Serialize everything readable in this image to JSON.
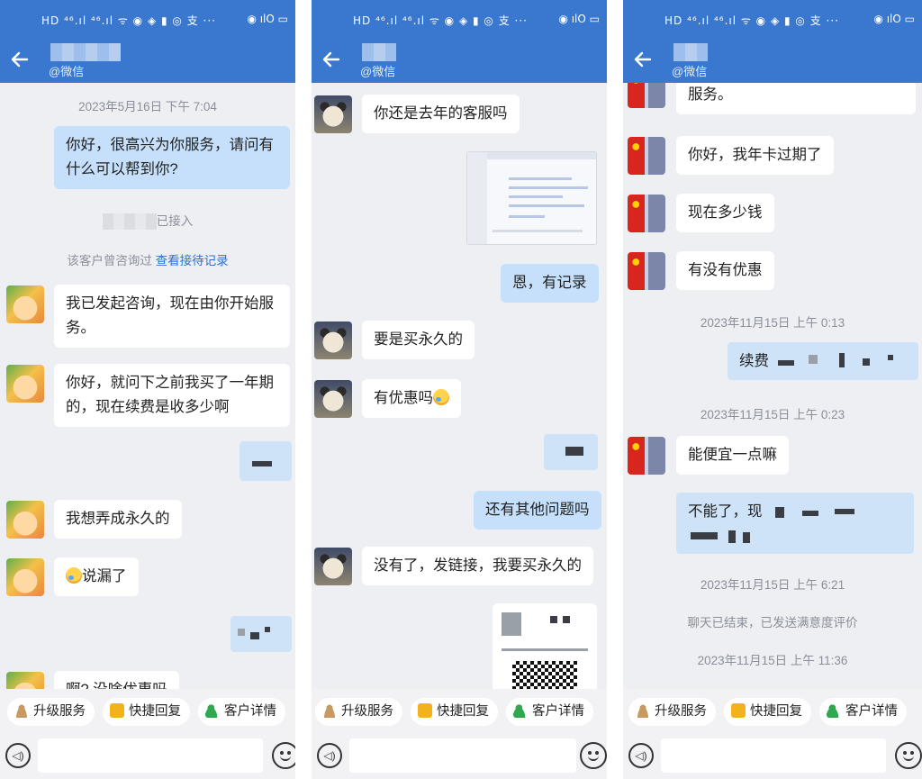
{
  "common": {
    "subtitle": "@微信",
    "status_left": "HD ⁴⁶.ıl ⁴⁶.ıl ᯤ ◉ ◈ ▮ ◎ 支 ···",
    "status_right": "◉ ılO ▭",
    "quick": {
      "upgrade": "升级服务",
      "reply": "快捷回复",
      "detail": "客户详情"
    },
    "voice_glyph": "◁)"
  },
  "p1": {
    "ts1": "2023年5月16日  下午 7:04",
    "m1": "你好，很高兴为你服务，请问有什么可以帮到你?",
    "sys1": "已接入",
    "sys2_text": "该客户曾咨询过",
    "sys2_link": "查看接待记录",
    "m2": "我已发起咨询，现在由你开始服务。",
    "m3": "你好，就问下之前我买了一年期的，现在续费是收多少啊",
    "m4": "我想弄成永久的",
    "m5": "说漏了",
    "m6": "啊?  没啥优惠吗"
  },
  "p2": {
    "m1": "你还是去年的客服吗",
    "m2": "恩，有记录",
    "m3": "要是买永久的",
    "m4": "有优惠吗",
    "m5": "还有其他问题吗",
    "m6": "没有了，发链接，我要买永久的",
    "detail_label": "客户详情"
  },
  "p3": {
    "m0": "服务。",
    "m1": "你好，我年卡过期了",
    "m2": "现在多少钱",
    "m3": "有没有优惠",
    "ts1": "2023年11月15日  上午 0:13",
    "m4": "续费",
    "ts2": "2023年11月15日  上午 0:23",
    "m5": "能便宜一点嘛",
    "m6": "不能了，现",
    "ts3": "2023年11月15日  上午 6:21",
    "sys1": "聊天已结束，已发送满意度评价",
    "ts4": "2023年11月15日  上午 11:36"
  }
}
